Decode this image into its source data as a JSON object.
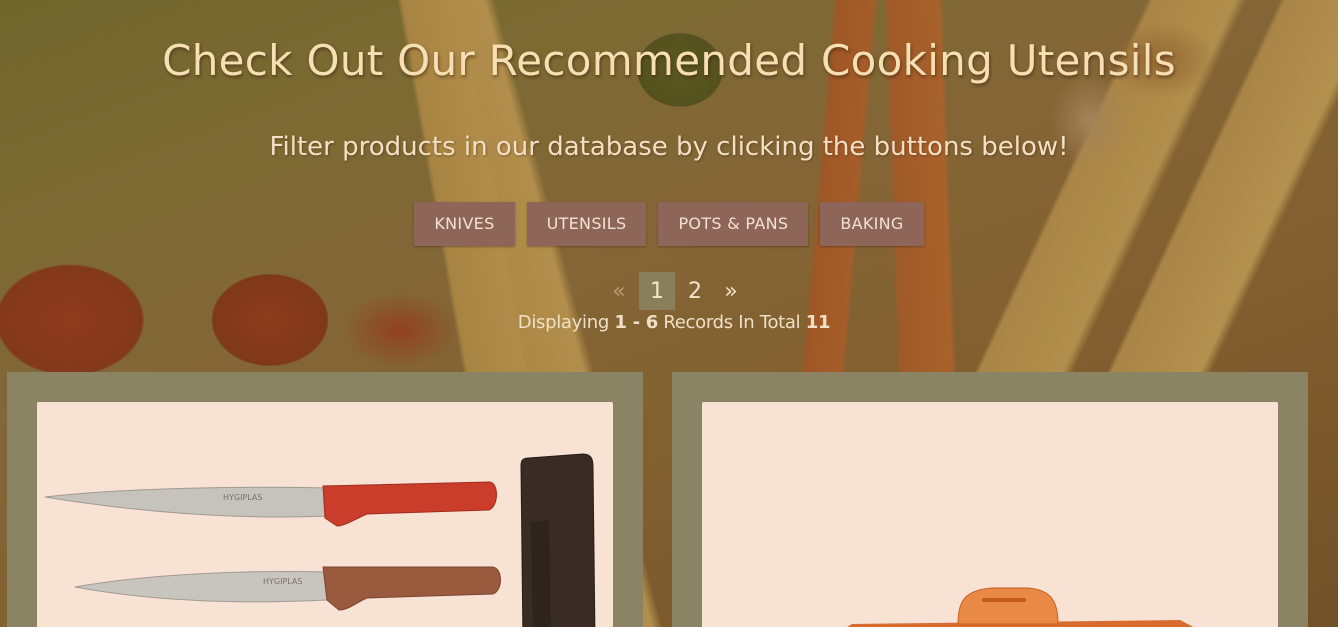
{
  "hero": {
    "title": "Check Out Our Recommended Cooking Utensils",
    "subtitle": "Filter products in our database by clicking the buttons below!"
  },
  "filters": [
    "KNIVES",
    "UTENSILS",
    "POTS & PANS",
    "BAKING"
  ],
  "pagination": {
    "prev": "«",
    "pages": [
      "1",
      "2"
    ],
    "active_page": "1",
    "next": "»"
  },
  "records": {
    "prefix": "Displaying ",
    "from": "1",
    "separator": " - ",
    "to": "6",
    "middle": " Records In Total ",
    "total": "11"
  },
  "products": [
    {
      "image": "chef-knives-image",
      "brand_mark": "HYGIPLAS"
    },
    {
      "image": "orange-container-image"
    }
  ],
  "colors": {
    "title": "#f6dfb2",
    "filter_button": "#8e6559",
    "card": "#8a8465",
    "image_bg": "#f8e2d3"
  }
}
